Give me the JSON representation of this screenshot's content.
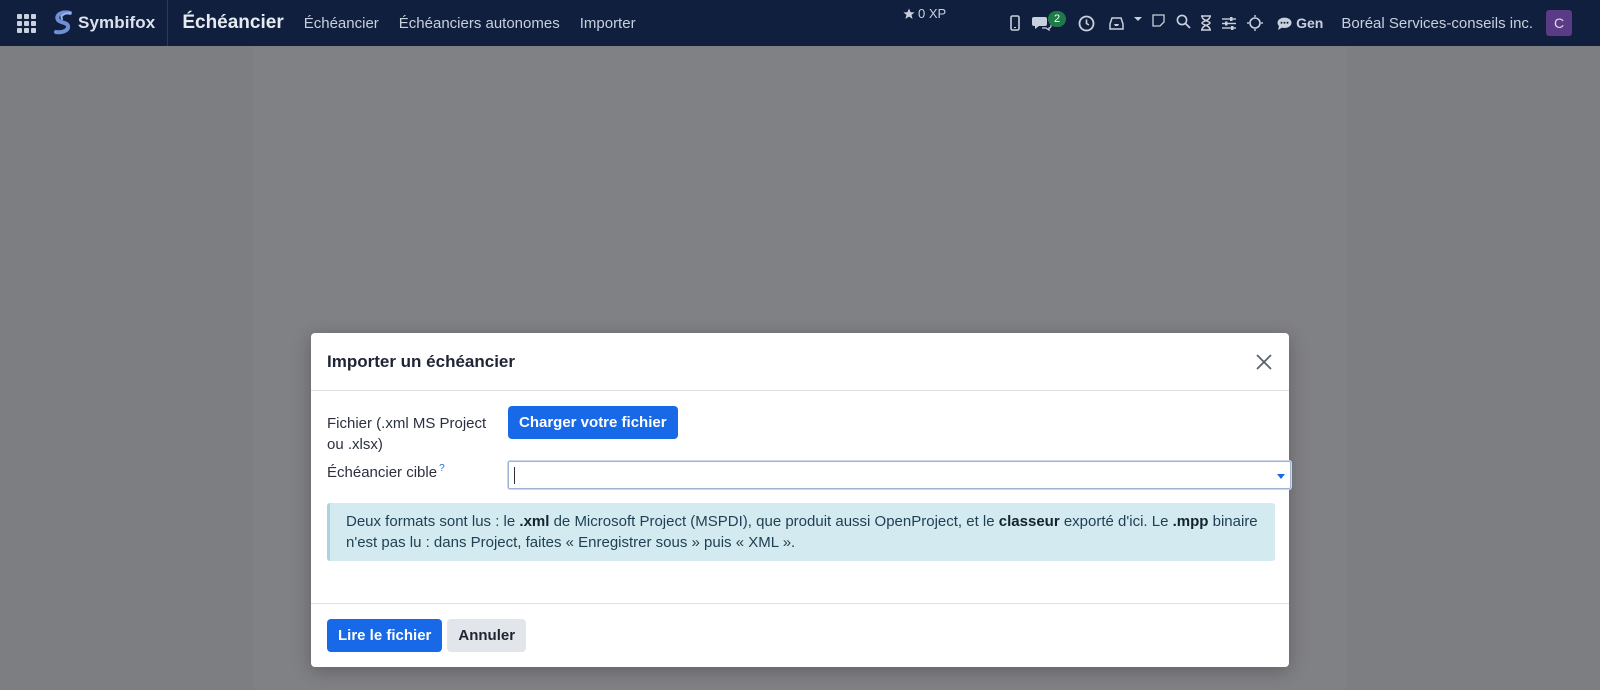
{
  "navbar": {
    "brand": "Symbifox",
    "app_title": "Échéancier",
    "menu": [
      "Échéancier",
      "Échéanciers autonomes",
      "Importer"
    ],
    "xp": "0 XP",
    "chat_badge": "2",
    "gen_label": "Gen",
    "company": "Boréal Services-conseils inc.",
    "avatar_letter": "C"
  },
  "modal": {
    "title": "Importer un échéancier",
    "file_label": "Fichier (.xml MS Project ou .xlsx)",
    "upload_button": "Charger votre fichier",
    "target_label": "Échéancier cible",
    "target_help": "?",
    "target_value": "",
    "info": {
      "p1": "Deux formats sont lus : le ",
      "b1": ".xml",
      "p2": " de Microsoft Project (MSPDI), que produit aussi OpenProject, et le ",
      "b2": "classeur",
      "p3": " exporté d'ici. Le ",
      "b3": ".mpp",
      "p4": " binaire n'est pas lu : dans Project, faites « Enregistrer sous » puis « XML »."
    },
    "read_button": "Lire le fichier",
    "cancel_button": "Annuler"
  },
  "colors": {
    "navbar_bg": "#0f1f3d",
    "primary": "#1769e8",
    "info_bg": "#d3eaf0",
    "avatar_bg": "#5b3a86",
    "badge_bg": "#1e7a46"
  }
}
